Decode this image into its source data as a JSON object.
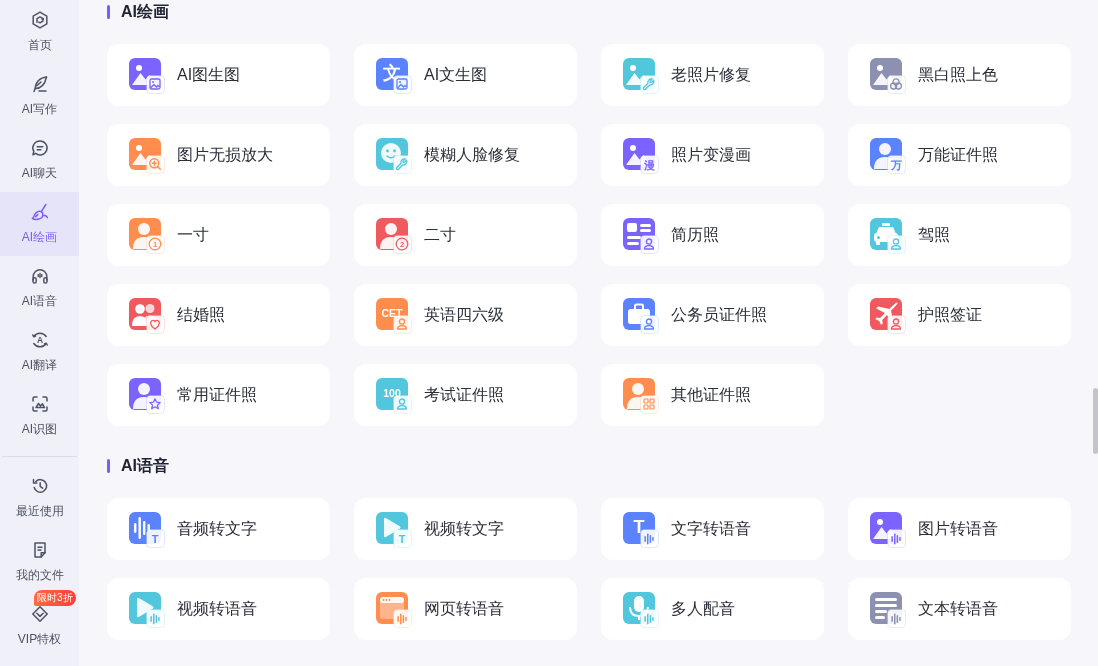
{
  "sidebar": {
    "items": [
      {
        "label": "首页",
        "selected": false
      },
      {
        "label": "AI写作",
        "selected": false
      },
      {
        "label": "AI聊天",
        "selected": false
      },
      {
        "label": "AI绘画",
        "selected": true
      },
      {
        "label": "AI语音",
        "selected": false
      },
      {
        "label": "AI翻译",
        "icon_text": "A",
        "selected": false
      },
      {
        "label": "AI识图",
        "selected": false
      }
    ],
    "bottom_items": [
      {
        "label": "最近使用",
        "selected": false
      },
      {
        "label": "我的文件",
        "selected": false
      },
      {
        "label": "VIP特权",
        "badge": "限时3折",
        "selected": false
      }
    ]
  },
  "sections": [
    {
      "title": "AI绘画",
      "tools": [
        {
          "label": "AI图生图",
          "icon": {
            "color": "#7c62ff"
          }
        },
        {
          "label": "AI文生图",
          "icon": {
            "tile_text": "文",
            "color": "#5b82ff"
          }
        },
        {
          "label": "老照片修复",
          "icon": {
            "color": "#52c6dd"
          }
        },
        {
          "label": "黑白照上色",
          "icon": {
            "color": "#8c91b1"
          }
        },
        {
          "label": "图片无损放大",
          "icon": {
            "color": "#ff8d4d"
          }
        },
        {
          "label": "模糊人脸修复",
          "icon": {
            "color": "#52c6dd"
          }
        },
        {
          "label": "照片变漫画",
          "icon": {
            "badge_text": "漫",
            "color": "#7c62ff"
          }
        },
        {
          "label": "万能证件照",
          "icon": {
            "badge_text": "万",
            "color": "#5b82ff"
          }
        },
        {
          "label": "一寸",
          "icon": {
            "badge_text": "1",
            "color": "#ff8d4d"
          }
        },
        {
          "label": "二寸",
          "icon": {
            "badge_text": "2",
            "color": "#f05a5f"
          }
        },
        {
          "label": "简历照",
          "icon": {
            "color": "#7c62ff"
          }
        },
        {
          "label": "驾照",
          "icon": {
            "color": "#52c6dd"
          }
        },
        {
          "label": "结婚照",
          "icon": {
            "color": "#f05a5f"
          }
        },
        {
          "label": "英语四六级",
          "icon": {
            "tile_text": "CET",
            "color": "#ff8d4d"
          }
        },
        {
          "label": "公务员证件照",
          "icon": {
            "color": "#5b82ff"
          }
        },
        {
          "label": "护照签证",
          "icon": {
            "color": "#f05a5f"
          }
        },
        {
          "label": "常用证件照",
          "icon": {
            "color": "#7c62ff"
          }
        },
        {
          "label": "考试证件照",
          "icon": {
            "tile_text": "100",
            "color": "#52c6dd"
          }
        },
        {
          "label": "其他证件照",
          "icon": {
            "color": "#ff8d4d"
          }
        }
      ]
    },
    {
      "title": "AI语音",
      "tools": [
        {
          "label": "音频转文字",
          "icon": {
            "badge_text": "T",
            "color": "#5b82ff"
          }
        },
        {
          "label": "视频转文字",
          "icon": {
            "badge_text": "T",
            "color": "#52c6dd"
          }
        },
        {
          "label": "文字转语音",
          "icon": {
            "tile_text": "T",
            "color": "#5b82ff"
          }
        },
        {
          "label": "图片转语音",
          "icon": {
            "color": "#7c62ff"
          }
        },
        {
          "label": "视频转语音",
          "icon": {
            "color": "#52c6dd"
          }
        },
        {
          "label": "网页转语音",
          "icon": {
            "color": "#ff8d4d"
          }
        },
        {
          "label": "多人配音",
          "icon": {
            "color": "#52c6dd"
          }
        },
        {
          "label": "文本转语音",
          "icon": {
            "color": "#8c91b1"
          }
        }
      ]
    }
  ]
}
